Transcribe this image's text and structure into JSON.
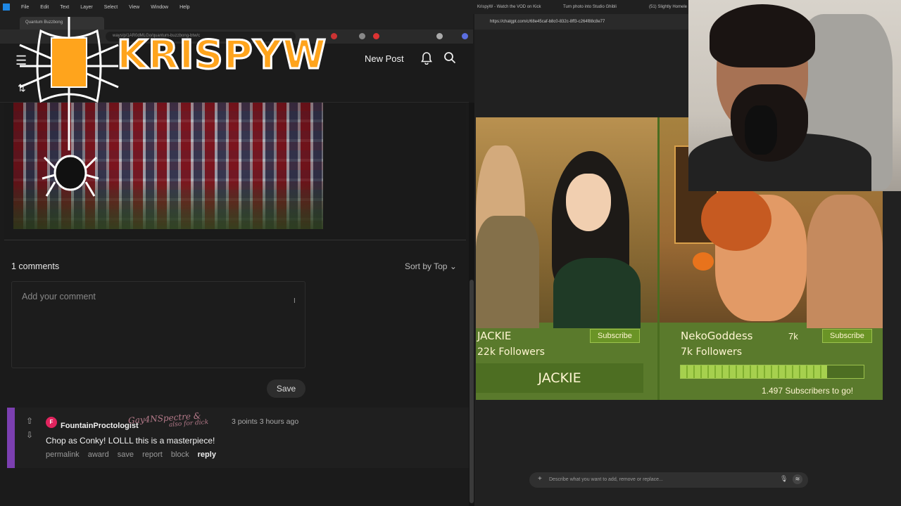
{
  "menubar": {
    "items": [
      "File",
      "Edit",
      "Text",
      "Layer",
      "Select",
      "View",
      "Window",
      "Help"
    ]
  },
  "left_browser": {
    "tab_title": "Quantum Buzzbong",
    "url": "ways/p/1AR0dMLGo/quantum-buzzbong-btw/c"
  },
  "site_header": {
    "new_post": "New Post"
  },
  "logo": {
    "text": "KRISPYW"
  },
  "comments": {
    "count_label": "1 comments",
    "sort_label": "Sort by Top",
    "placeholder": "Add your comment",
    "save_label": "Save",
    "items": [
      {
        "avatar_letter": "F",
        "author": "FountainProctologist",
        "points": "3 points",
        "time": "3 hours ago",
        "text": "Chop as Conky! LOLLL this is a masterpiece!",
        "actions": [
          "permalink",
          "award",
          "save",
          "report",
          "block",
          "reply"
        ]
      }
    ]
  },
  "overlay": {
    "line1": "Gay4NSpectre &",
    "line2": "also for dick"
  },
  "right_browser": {
    "tabs": [
      "KrispyW - Watch the VOD on Kick",
      "Turn photo into Studio Ghibli",
      "(51) Slightly Homele"
    ],
    "url": "https://chatgpt.com/c/68e45caf-b8c0-832c-8ff3-c264f88c8e77"
  },
  "subs": {
    "left": {
      "name": "JACKIE",
      "followers": "22k Followers",
      "button": "Subscribe",
      "bar": "JACKIE"
    },
    "right": {
      "name": "NekoGoddess",
      "followers": "7k Followers",
      "count": "7k",
      "button": "Subscribe",
      "progress_text": "1.497 Subscribers to go!",
      "progress": 0.8
    }
  },
  "prompt": {
    "placeholder": "Describe what you want to add, remove or replace..."
  }
}
